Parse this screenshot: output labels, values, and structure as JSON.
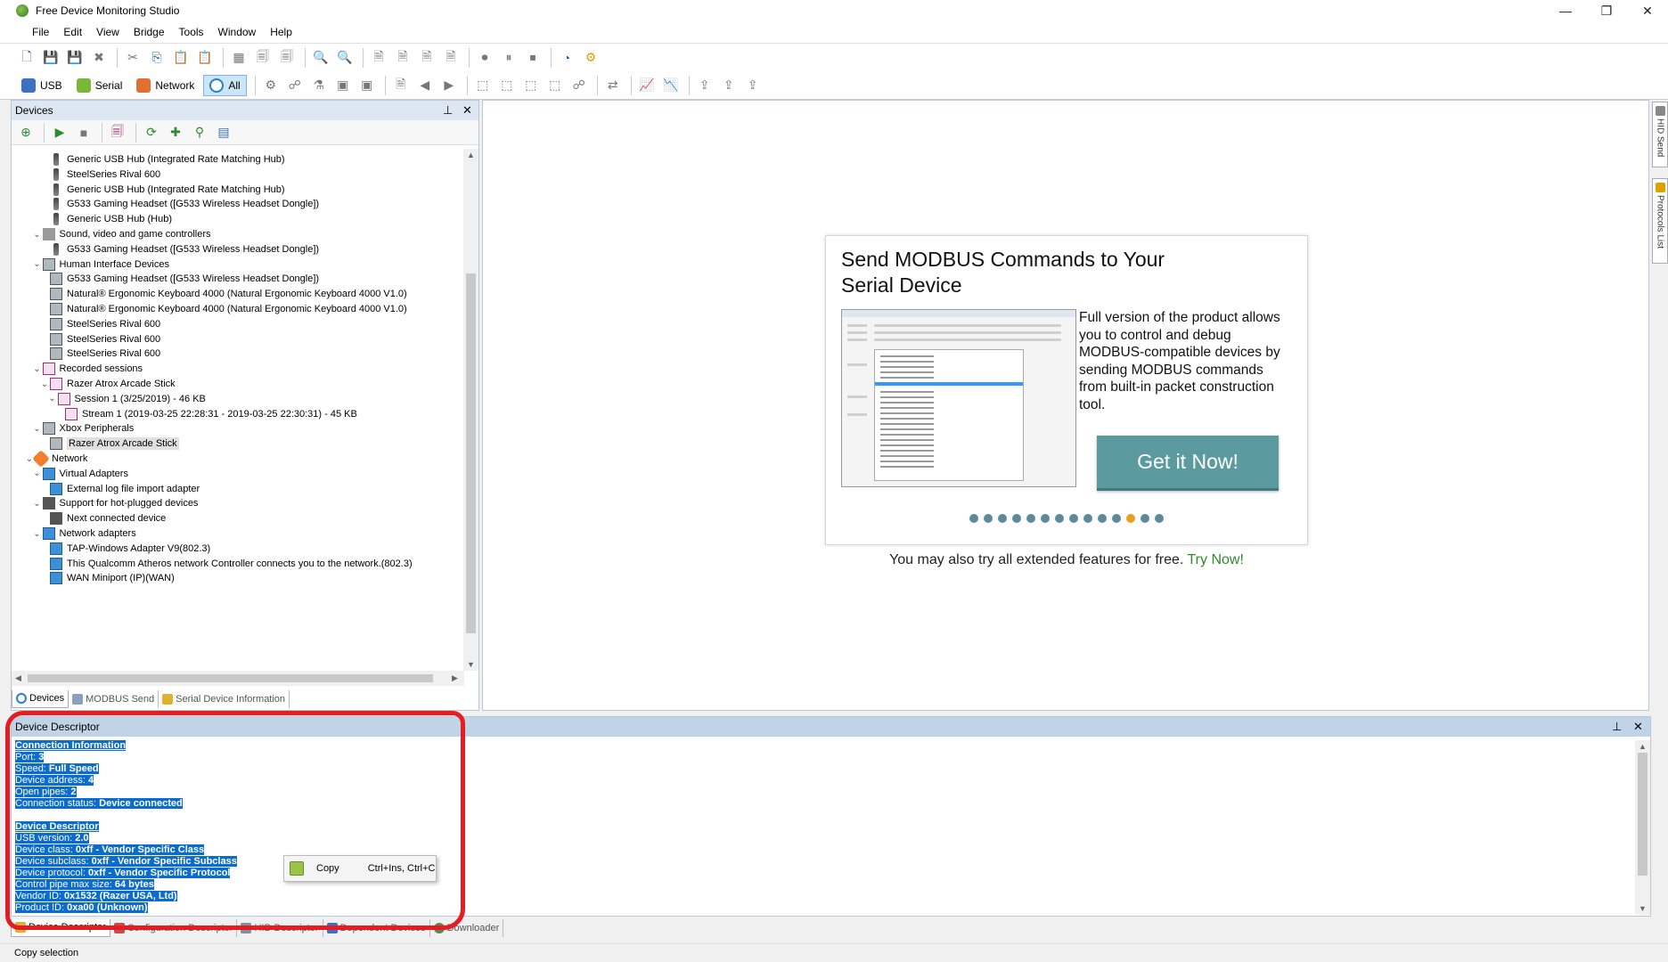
{
  "window": {
    "title": "Free Device Monitoring Studio",
    "controls": [
      "—",
      "❐",
      "✕"
    ]
  },
  "menu": [
    "File",
    "Edit",
    "View",
    "Bridge",
    "Tools",
    "Window",
    "Help"
  ],
  "filters": {
    "usb": "USB",
    "serial": "Serial",
    "network": "Network",
    "all": "All"
  },
  "devices_panel": {
    "title": "Devices",
    "tree": [
      {
        "label": "Generic USB Hub (Integrated Rate Matching Hub)",
        "icon": "usb-icon",
        "level": 3
      },
      {
        "label": "SteelSeries Rival 600",
        "icon": "usb-icon",
        "level": 3
      },
      {
        "label": "Generic USB Hub (Integrated Rate Matching Hub)",
        "icon": "usb-icon",
        "level": 3
      },
      {
        "label": "G533 Gaming Headset ([G533 Wireless Headset Dongle])",
        "icon": "usb-icon",
        "level": 3
      },
      {
        "label": "Generic USB Hub (Hub)",
        "icon": "usb-icon",
        "level": 3
      },
      {
        "label": "Sound, video and game controllers",
        "icon": "speaker-icon",
        "level": 2,
        "expanded": true
      },
      {
        "label": "G533 Gaming Headset ([G533 Wireless Headset Dongle])",
        "icon": "usb-icon",
        "level": 3
      },
      {
        "label": "Human Interface Devices",
        "icon": "hid-icon",
        "level": 2,
        "expanded": true
      },
      {
        "label": "G533 Gaming Headset ([G533 Wireless Headset Dongle])",
        "icon": "hid-icon",
        "level": 3
      },
      {
        "label": "Natural® Ergonomic Keyboard 4000 (Natural Ergonomic Keyboard 4000 V1.0)",
        "icon": "hid-icon",
        "level": 3
      },
      {
        "label": "Natural® Ergonomic Keyboard 4000 (Natural Ergonomic Keyboard 4000 V1.0)",
        "icon": "hid-icon",
        "level": 3
      },
      {
        "label": "SteelSeries Rival 600",
        "icon": "hid-icon",
        "level": 3
      },
      {
        "label": "SteelSeries Rival 600",
        "icon": "hid-icon",
        "level": 3
      },
      {
        "label": "SteelSeries Rival 600",
        "icon": "hid-icon",
        "level": 3
      },
      {
        "label": "Recorded sessions",
        "icon": "recording-icon",
        "level": 2,
        "expanded": true
      },
      {
        "label": "Razer Atrox Arcade Stick",
        "icon": "recording-icon",
        "level": 3,
        "expanded": true
      },
      {
        "label": "Session 1 (3/25/2019) - 46 KB",
        "icon": "recording-icon",
        "level": 4,
        "expanded": true
      },
      {
        "label": "Stream 1 (2019-03-25 22:28:31 - 2019-03-25 22:30:31) - 45 KB",
        "icon": "recording-icon",
        "level": 5
      },
      {
        "label": "Xbox Peripherals",
        "icon": "hid-icon",
        "level": 2,
        "expanded": true
      },
      {
        "label": "Razer Atrox Arcade Stick",
        "icon": "hid-icon",
        "level": 3,
        "selected": true
      },
      {
        "label": "Network",
        "icon": "network-icon",
        "level": 1,
        "expanded": true
      },
      {
        "label": "Virtual Adapters",
        "icon": "adapter-icon",
        "level": 2,
        "expanded": true
      },
      {
        "label": "External log file import adapter",
        "icon": "adapter-icon",
        "level": 3
      },
      {
        "label": "Support for hot-plugged devices",
        "icon": "plug-icon",
        "level": 2,
        "expanded": true
      },
      {
        "label": "Next connected device",
        "icon": "plug-icon",
        "level": 3
      },
      {
        "label": "Network adapters",
        "icon": "adapter-icon",
        "level": 2,
        "expanded": true
      },
      {
        "label": "TAP-Windows Adapter V9(802.3)",
        "icon": "adapter-icon",
        "level": 3
      },
      {
        "label": "This Qualcomm Atheros network Controller connects you to the network.(802.3)",
        "icon": "adapter-icon",
        "level": 3
      },
      {
        "label": "WAN Miniport (IP)(WAN)",
        "icon": "adapter-icon",
        "level": 3
      }
    ],
    "tabs": [
      "Devices",
      "MODBUS Send",
      "Serial Device Information"
    ]
  },
  "promo": {
    "title": "Send MODBUS Commands to Your Serial Device",
    "description": "Full version of the product allows you to control and debug MODBUS-compatible devices by sending MODBUS commands from built-in packet construction tool.",
    "button": "Get it Now!",
    "carousel_count": 14,
    "carousel_active": 11,
    "footer_text": "You may also try all extended features for free.",
    "footer_link": "Try Now!"
  },
  "side_tabs": [
    "HID Send",
    "Protocols List"
  ],
  "descriptor_panel": {
    "title": "Device Descriptor",
    "lines": [
      {
        "kind": "heading",
        "text": "Connection Information"
      },
      {
        "label": "Port: ",
        "value": "3"
      },
      {
        "label": "Speed: ",
        "value": "Full Speed"
      },
      {
        "label": "Device address: ",
        "value": "4"
      },
      {
        "label": "Open pipes: ",
        "value": "2"
      },
      {
        "label": "Connection status: ",
        "value": "Device connected"
      },
      {
        "kind": "blank",
        "text": " "
      },
      {
        "kind": "heading",
        "text": "Device Descriptor"
      },
      {
        "label": "USB version: ",
        "value": "2.0"
      },
      {
        "label": "Device class: ",
        "value": "0xff - Vendor Specific Class"
      },
      {
        "label": "Device subclass: ",
        "value": "0xff - Vendor Specific Subclass"
      },
      {
        "label": "Device protocol: ",
        "value": "0xff - Vendor Specific Protocol"
      },
      {
        "label": "Control pipe max size: ",
        "value": "64 bytes"
      },
      {
        "label": "Vendor ID: ",
        "value": "0x1532 (Razer USA, Ltd)"
      },
      {
        "label": "Product ID: ",
        "value": "0xa00 (Unknown)"
      }
    ],
    "tabs": [
      "Device Descriptor",
      "Configuration Descriptor",
      "HID Descriptor",
      "Dependent Devices",
      "Downloader"
    ]
  },
  "context_menu": {
    "label": "Copy",
    "shortcut": "Ctrl+Ins, Ctrl+C"
  },
  "status": "Copy selection",
  "colors": {
    "selection": "#0a6cce",
    "annotation": "#e51d23",
    "button": "#5b9ba0",
    "link": "#2e8b2e"
  }
}
